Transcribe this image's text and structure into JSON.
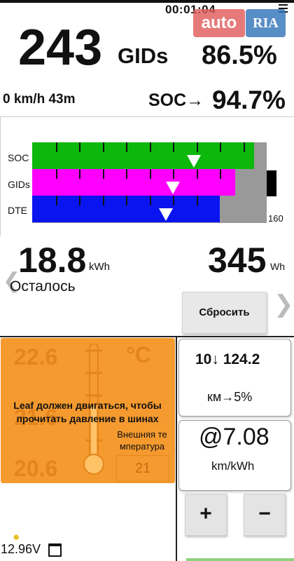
{
  "status_bar": {
    "clock": "00:01:04"
  },
  "watermark": {
    "left": "auto",
    "right": "RIA"
  },
  "main": {
    "gids_value": "243",
    "gids_unit": "GIDs",
    "gids_percent": "86.5%",
    "speed_time": "0 km/h 43m",
    "soc_label": "SOC→",
    "soc_value": "94.7%"
  },
  "graph": {
    "rows": [
      {
        "label": "SOC",
        "color": "#0cb80c",
        "fill": 0.946,
        "marker": 0.69
      },
      {
        "label": "GIDs",
        "color": "#ff00ff",
        "fill": 0.865,
        "marker": 0.6
      },
      {
        "label": "DTE",
        "color": "#0a14f0",
        "fill": 0.8,
        "marker": 0.57
      }
    ],
    "max_label": "160"
  },
  "energy": {
    "kwh_value": "18.8",
    "kwh_unit": "kWh",
    "remaining_label": "Осталось",
    "wh_value": "345",
    "wh_unit": "Wh",
    "reset_label": "Сбросить"
  },
  "tyre_panel": {
    "top_value": "22.6",
    "mid_value": "21.6",
    "bottom_value": "20.6",
    "unit": "°C",
    "message": "Leaf должен двигаться, чтобы прочитать давление в шинах",
    "outside_label": "Внешняя те мпература",
    "outside_value": "21"
  },
  "stats": {
    "card1_top": "10↓ 124.2",
    "card1_bottom": "км→5%",
    "card2_top": "@7.08",
    "card2_bottom": "km/kWh"
  },
  "buttons": {
    "plus": "+",
    "minus": "−"
  },
  "footer": {
    "voltage": "12.96V"
  },
  "colors": {
    "accent_orange": "#f59a2f",
    "soc_green": "#0cb80c",
    "gids_magenta": "#ff00ff",
    "dte_blue": "#0a14f0"
  }
}
